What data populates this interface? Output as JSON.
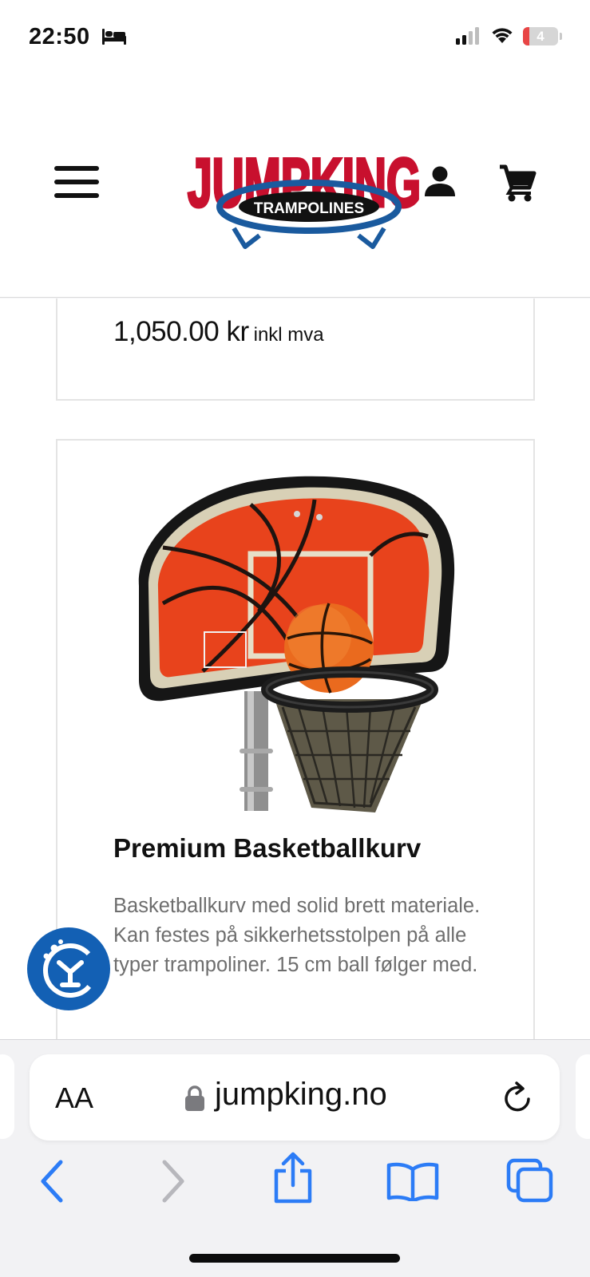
{
  "status_bar": {
    "time": "22:50",
    "battery": "4",
    "icons": [
      "bed-icon",
      "signal-icon",
      "wifi-icon",
      "battery-icon"
    ]
  },
  "header": {
    "logo": {
      "brand": "JUMPKING",
      "tagline": "TRAMPOLINES",
      "colors": {
        "red": "#c8102e",
        "blue": "#1a5a9e",
        "black": "#111111"
      }
    },
    "icons": [
      "menu-icon",
      "account-icon",
      "cart-icon"
    ]
  },
  "previous_product": {
    "price": "1,050.00 kr",
    "vat_note": "inkl mva"
  },
  "product": {
    "title": "Premium Basketballkurv",
    "description": "Basketballkurv med solid brett materiale. Kan festes på sikkerhetsstolpen på alle typer trampoliner. 15 cm ball følger med.",
    "image": "basketball-hoop-image"
  },
  "browser": {
    "text_size_label": "AA",
    "url": "jumpking.no",
    "accent": "#2c7cf6",
    "icons": [
      "lock-icon",
      "reload-icon",
      "back-icon",
      "forward-icon",
      "share-icon",
      "bookmarks-icon",
      "tabs-icon"
    ]
  },
  "accessibility": {
    "icon": "accessibility-icon",
    "color": "#1360b4"
  }
}
